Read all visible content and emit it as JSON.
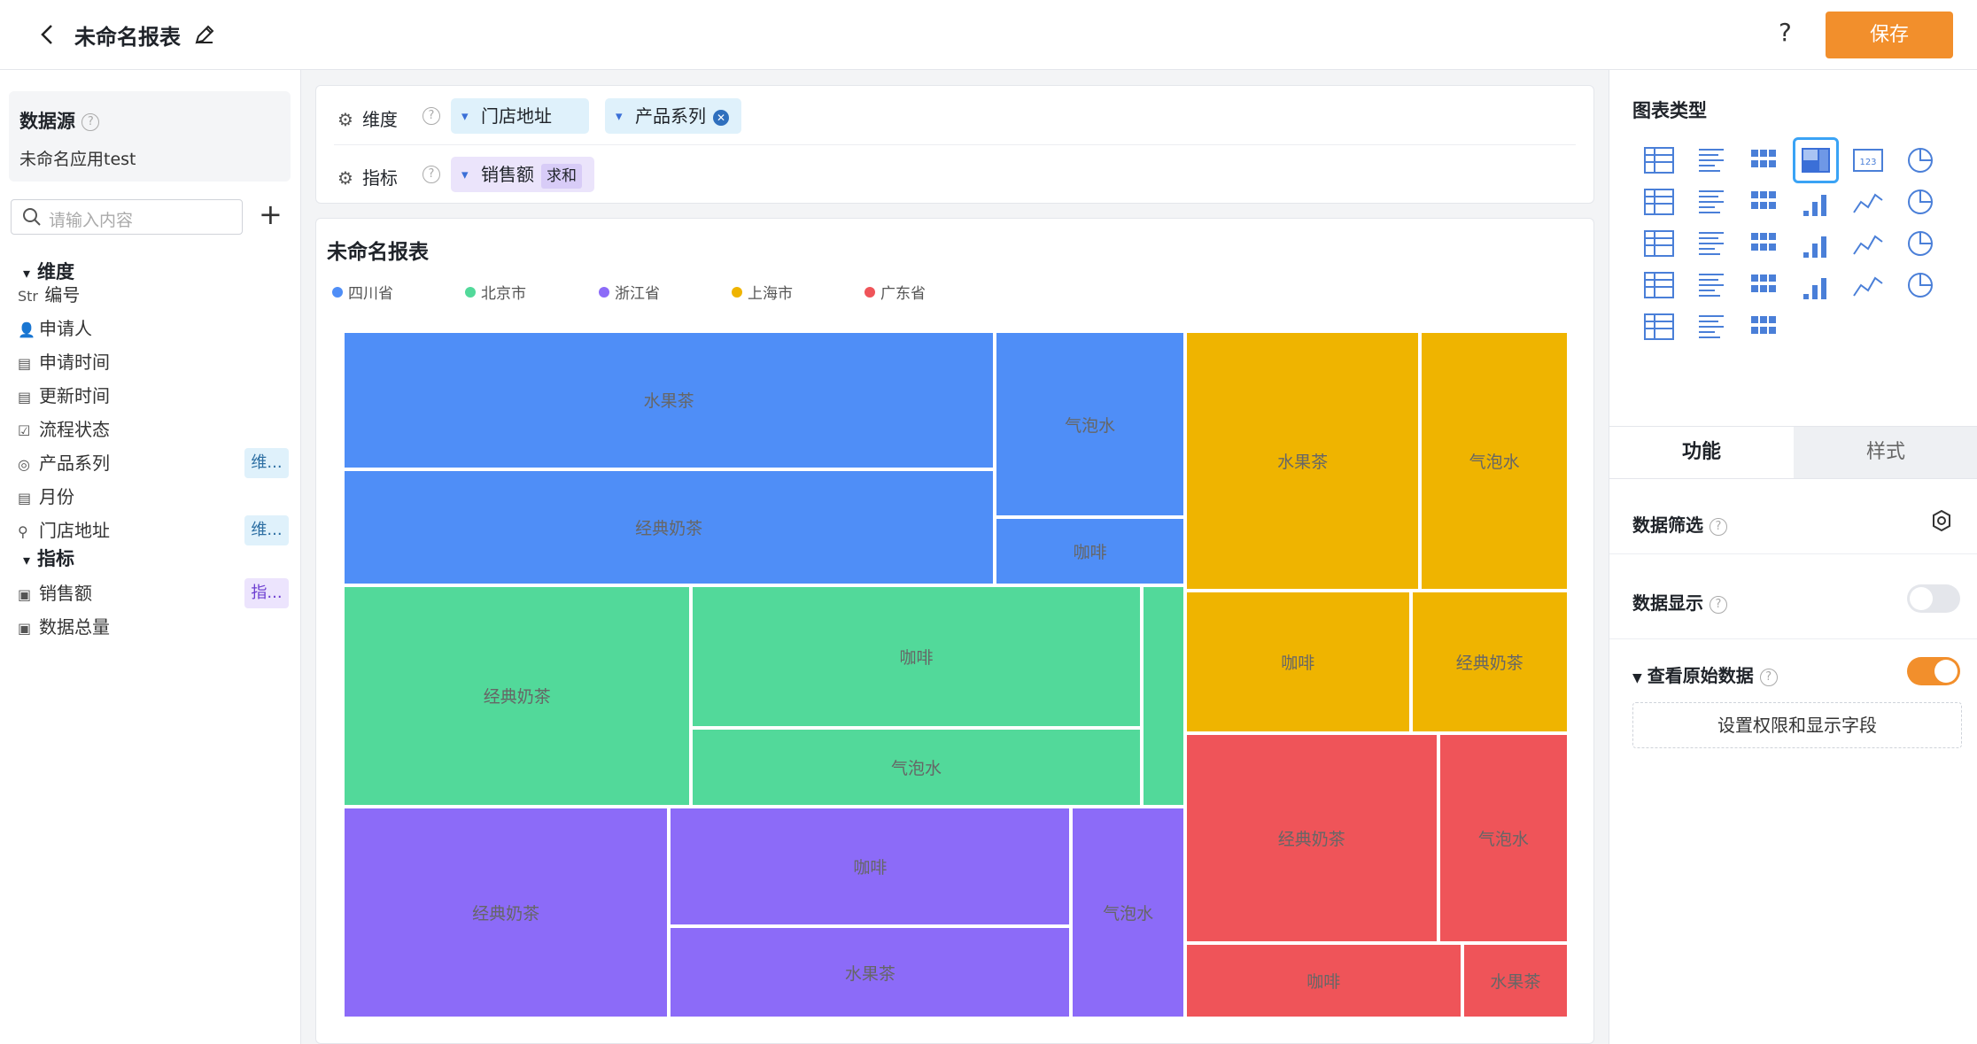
{
  "header": {
    "title": "未命名报表",
    "help": "?",
    "save_label": "保存"
  },
  "datasource": {
    "title": "数据源",
    "name": "未命名应用test"
  },
  "search": {
    "placeholder": "请输入内容"
  },
  "groups": {
    "dimension": "维度",
    "metric": "指标"
  },
  "fields": [
    {
      "icon": "Str",
      "label": "编号"
    },
    {
      "icon": "person-icon",
      "label": "申请人"
    },
    {
      "icon": "calendar-icon",
      "label": "申请时间"
    },
    {
      "icon": "calendar-icon",
      "label": "更新时间"
    },
    {
      "icon": "checkbox-icon",
      "label": "流程状态"
    },
    {
      "icon": "target-icon",
      "label": "产品系列",
      "tag": "维..."
    },
    {
      "icon": "calendar-icon",
      "label": "月份"
    },
    {
      "icon": "location-icon",
      "label": "门店地址",
      "tag": "维..."
    }
  ],
  "metrics": [
    {
      "icon": "number-icon",
      "label": "销售额",
      "tag": "指..."
    },
    {
      "icon": "number-icon",
      "label": "数据总量"
    }
  ],
  "fieldbar": {
    "dimension_label": "维度",
    "metric_label": "指标",
    "dimension_chips": [
      "门店地址",
      "产品系列"
    ],
    "metric_chip": "销售额",
    "metric_agg": "求和"
  },
  "chart_data": {
    "type": "treemap",
    "title": "未命名报表",
    "legend": [
      {
        "name": "四川省",
        "color": "#4f8ef7"
      },
      {
        "name": "北京市",
        "color": "#52d99a"
      },
      {
        "name": "浙江省",
        "color": "#8c6bf8"
      },
      {
        "name": "上海市",
        "color": "#efb400"
      },
      {
        "name": "广东省",
        "color": "#ef5459"
      }
    ],
    "groups": [
      {
        "name": "四川省",
        "children": [
          {
            "name": "水果茶",
            "value": 56
          },
          {
            "name": "经典奶茶",
            "value": 47
          },
          {
            "name": "气泡水",
            "value": 22
          },
          {
            "name": "咖啡",
            "value": 8
          }
        ]
      },
      {
        "name": "北京市",
        "children": [
          {
            "name": "经典奶茶",
            "value": 48
          },
          {
            "name": "咖啡",
            "value": 40
          },
          {
            "name": "气泡水",
            "value": 22
          },
          {
            "name": "",
            "value": 6
          }
        ]
      },
      {
        "name": "浙江省",
        "children": [
          {
            "name": "经典奶茶",
            "value": 43
          },
          {
            "name": "咖啡",
            "value": 30
          },
          {
            "name": "水果茶",
            "value": 23
          },
          {
            "name": "气泡水",
            "value": 15
          }
        ]
      },
      {
        "name": "上海市",
        "children": [
          {
            "name": "水果茶",
            "value": 38
          },
          {
            "name": "气泡水",
            "value": 24
          },
          {
            "name": "咖啡",
            "value": 20
          },
          {
            "name": "经典奶茶",
            "value": 14
          }
        ]
      },
      {
        "name": "广东省",
        "children": [
          {
            "name": "经典奶茶",
            "value": 33
          },
          {
            "name": "气泡水",
            "value": 17
          },
          {
            "name": "咖啡",
            "value": 13
          },
          {
            "name": "水果茶",
            "value": 5
          }
        ]
      }
    ]
  },
  "right": {
    "chart_type_title": "图表类型",
    "chart_types": [
      "table-icon",
      "detail-table-icon",
      "pivot-table-icon",
      "treemap-icon",
      "kpi-icon",
      "map-icon",
      "bar-icon",
      "stacked-bar-icon",
      "percent-bar-icon",
      "column-icon",
      "stacked-column-icon",
      "percent-column-icon",
      "histogram-icon",
      "waterfall-icon",
      "combo-icon",
      "line-icon",
      "area-icon",
      "stacked-area-icon",
      "percent-area-icon",
      "scatter-icon",
      "dot-line-icon",
      "funnel-icon",
      "pie-icon",
      "donut-icon",
      "rose-icon",
      "radar-icon",
      "gauge-icon"
    ],
    "selected": "treemap-icon",
    "tab_function": "功能",
    "tab_style": "样式",
    "filter_label": "数据筛选",
    "display_label": "数据显示",
    "display_on": false,
    "raw_label": "查看原始数据",
    "raw_on": true,
    "perm_label": "设置权限和显示字段"
  }
}
